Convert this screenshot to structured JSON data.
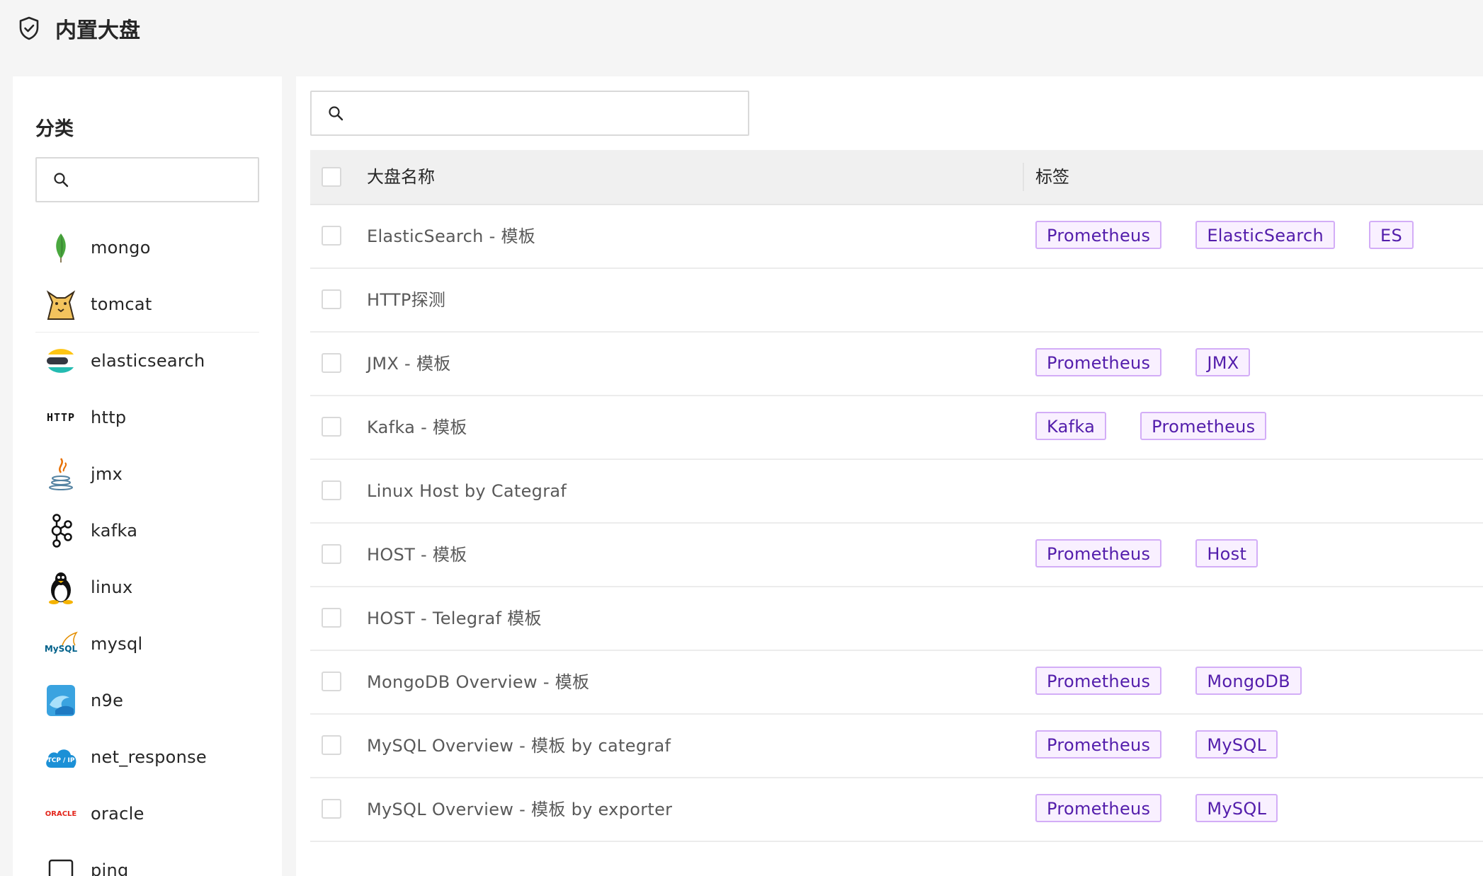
{
  "page": {
    "title": "内置大盘",
    "title_icon": "shield-check-icon"
  },
  "sidebar": {
    "title": "分类",
    "search": {
      "placeholder": "",
      "value": ""
    },
    "items": [
      {
        "label": "mongo",
        "icon": "mongo-icon"
      },
      {
        "label": "tomcat",
        "icon": "tomcat-icon"
      },
      {
        "label": "elasticsearch",
        "icon": "elasticsearch-icon"
      },
      {
        "label": "http",
        "icon": "http-icon",
        "icon_text": "HTTP"
      },
      {
        "label": "jmx",
        "icon": "java-icon"
      },
      {
        "label": "kafka",
        "icon": "kafka-icon"
      },
      {
        "label": "linux",
        "icon": "linux-icon"
      },
      {
        "label": "mysql",
        "icon": "mysql-icon",
        "icon_text": "MySQL"
      },
      {
        "label": "n9e",
        "icon": "n9e-icon"
      },
      {
        "label": "net_response",
        "icon": "tcp-ip-cloud-icon",
        "icon_text": "TCP / IP"
      },
      {
        "label": "oracle",
        "icon": "oracle-icon",
        "icon_text": "ORACLE"
      },
      {
        "label": "ping",
        "icon": "ping-icon"
      }
    ]
  },
  "main": {
    "search": {
      "placeholder": "",
      "value": ""
    },
    "table": {
      "columns": [
        "大盘名称",
        "标签"
      ],
      "rows": [
        {
          "name": "ElasticSearch - 模板",
          "tags": [
            "Prometheus",
            "ElasticSearch",
            "ES"
          ]
        },
        {
          "name": "HTTP探测",
          "tags": []
        },
        {
          "name": "JMX - 模板",
          "tags": [
            "Prometheus",
            "JMX"
          ]
        },
        {
          "name": "Kafka - 模板",
          "tags": [
            "Kafka",
            "Prometheus"
          ]
        },
        {
          "name": "Linux Host by Categraf",
          "tags": []
        },
        {
          "name": "HOST - 模板",
          "tags": [
            "Prometheus",
            "Host"
          ]
        },
        {
          "name": "HOST - Telegraf 模板",
          "tags": []
        },
        {
          "name": "MongoDB Overview - 模板",
          "tags": [
            "Prometheus",
            "MongoDB"
          ]
        },
        {
          "name": "MySQL Overview - 模板 by categraf",
          "tags": [
            "Prometheus",
            "MySQL"
          ]
        },
        {
          "name": "MySQL Overview - 模板 by exporter",
          "tags": [
            "Prometheus",
            "MySQL"
          ]
        }
      ]
    }
  },
  "colors": {
    "tag_border": "#d3adf7",
    "tag_bg": "#f9f0ff",
    "tag_text": "#531dab"
  }
}
